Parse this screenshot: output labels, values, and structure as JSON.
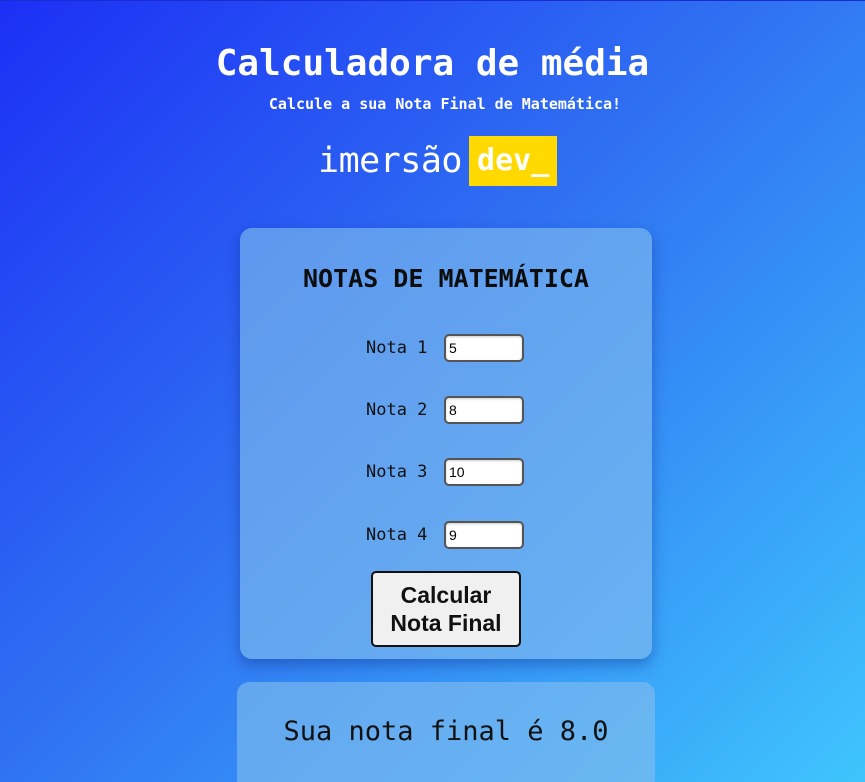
{
  "header": {
    "title": "Calculadora de média",
    "subtitle": "Calcule a sua Nota Final de Matemática!"
  },
  "brand": {
    "word": "imersão",
    "tag": "dev_",
    "tag_color": "#ffd900"
  },
  "card": {
    "title": "NOTAS DE MATEMÁTICA",
    "fields": [
      {
        "label": "Nota 1",
        "value": "5"
      },
      {
        "label": "Nota 2",
        "value": "8"
      },
      {
        "label": "Nota 3",
        "value": "10"
      },
      {
        "label": "Nota 4",
        "value": "9"
      }
    ],
    "button_line1": "Calcular",
    "button_line2": "Nota Final"
  },
  "result": {
    "text": "Sua nota final é 8.0"
  },
  "colors": {
    "gradient_start": "#1c2ff5",
    "gradient_end": "#3fc5fd"
  }
}
